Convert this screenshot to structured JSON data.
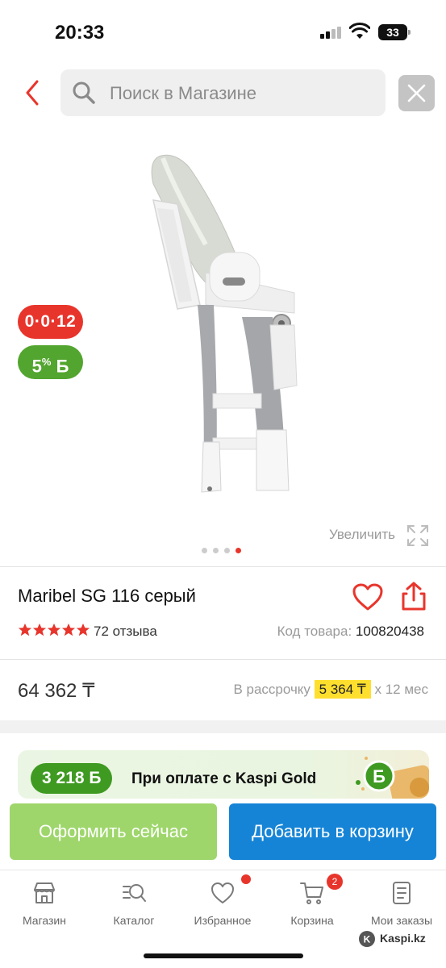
{
  "status_bar": {
    "time": "20:33",
    "battery": "33"
  },
  "search": {
    "placeholder": "Поиск в Магазине"
  },
  "badges": {
    "credit": "0·0·12",
    "bonus_percent": "5",
    "bonus_sign": "%",
    "bonus_symbol": "Б"
  },
  "gallery": {
    "zoom_label": "Увеличить",
    "total_images": 4,
    "active_index": 3
  },
  "product": {
    "title": "Maribel SG 116 серый",
    "rating": 5,
    "reviews": "72 отзыва",
    "sku_label": "Код товара:",
    "sku_value": "100820438",
    "price": "64 362 ₸",
    "installment_label": "В рассрочку",
    "installment_amount": "5 364 ₸",
    "installment_term": "х 12 мес"
  },
  "promo": {
    "amount": "3 218 Б",
    "text": "При оплате с Kaspi Gold"
  },
  "actions": {
    "buy_now": "Оформить сейчас",
    "add_to_cart": "Добавить в корзину"
  },
  "tabbar": {
    "items": [
      {
        "label": "Магазин",
        "icon": "store-icon"
      },
      {
        "label": "Каталог",
        "icon": "catalog-icon"
      },
      {
        "label": "Избранное",
        "icon": "heart-icon"
      },
      {
        "label": "Корзина",
        "icon": "cart-icon"
      },
      {
        "label": "Мои заказы",
        "icon": "orders-icon"
      }
    ],
    "cart_count": "2"
  },
  "watermark": "Kaspi.kz",
  "colors": {
    "accent_red": "#e8352c",
    "bonus_green": "#52a52e",
    "buy_now_green": "#9ed66b",
    "cart_blue": "#1584d6",
    "installment_yellow": "#ffdf2e"
  }
}
